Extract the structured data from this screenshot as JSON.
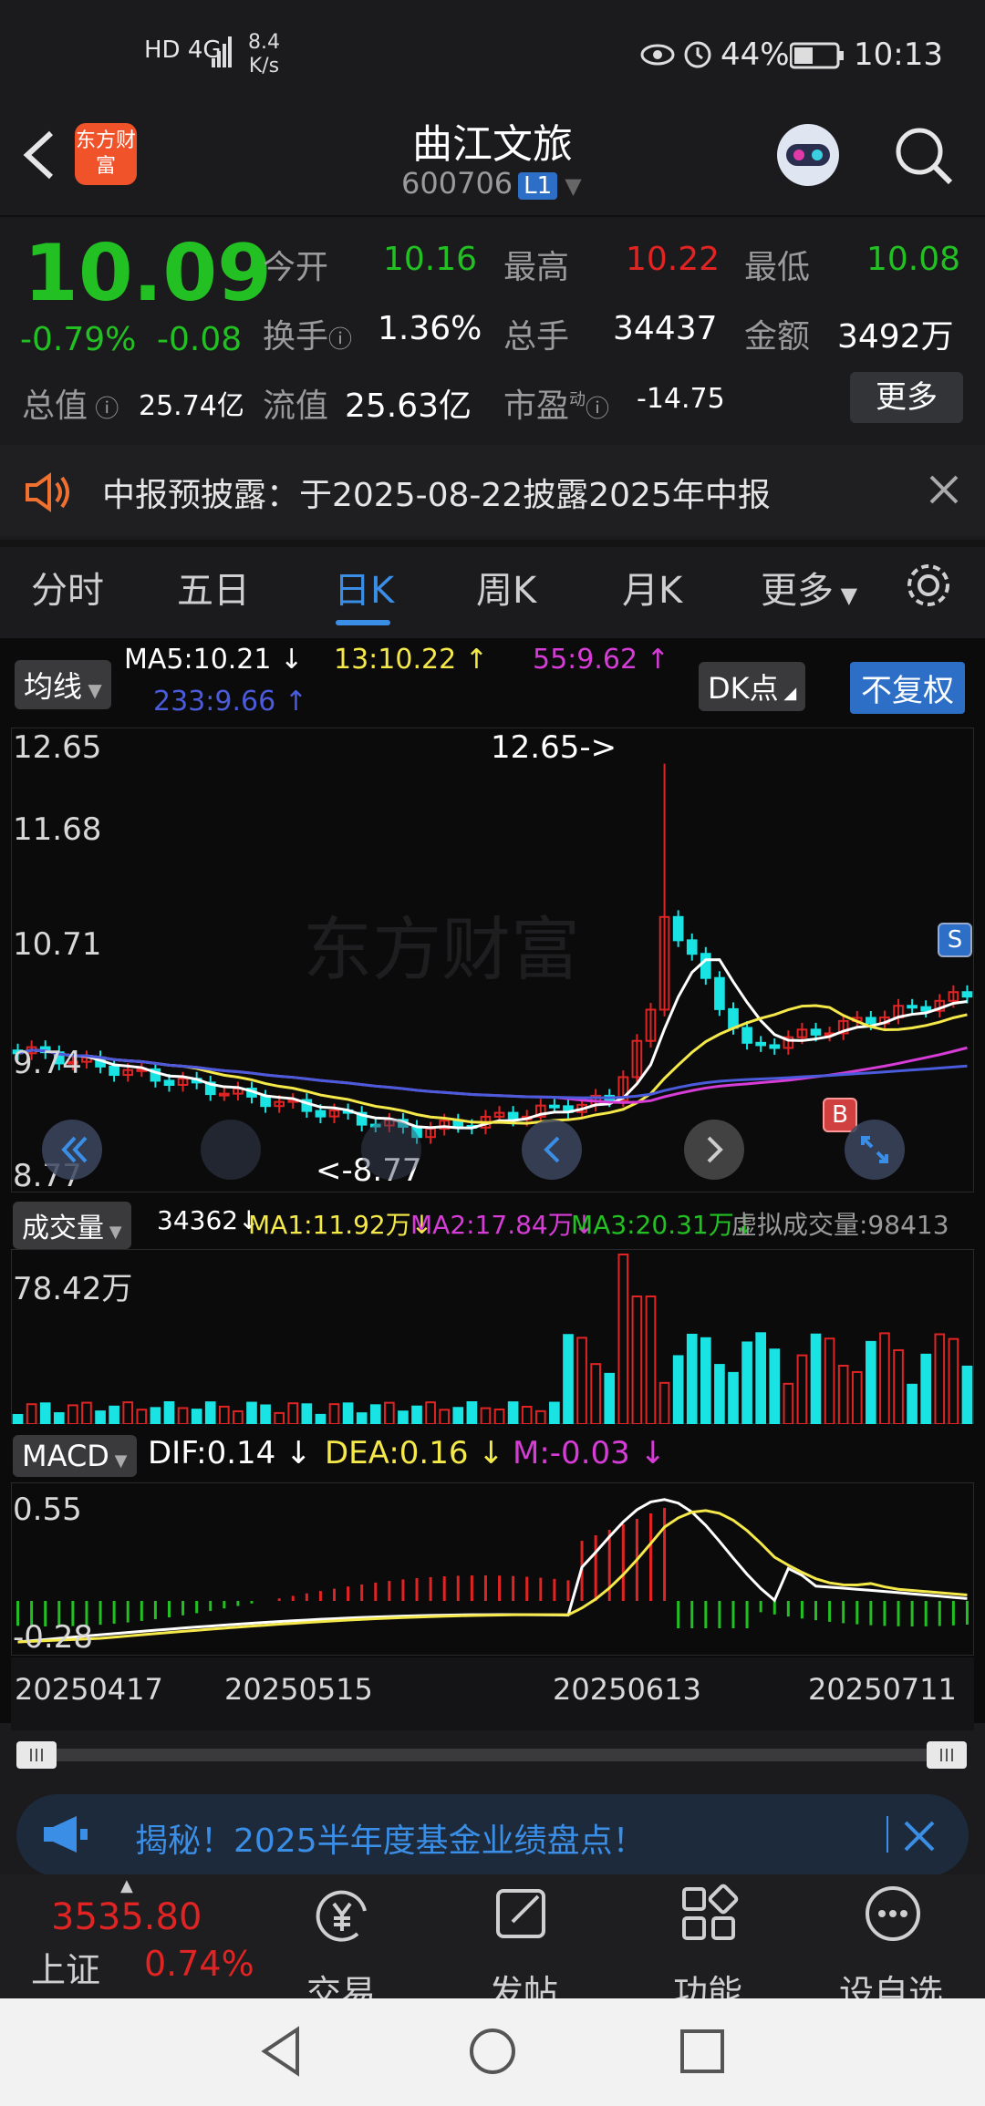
{
  "status_bar": {
    "left_icons": "HD 4G",
    "speed_value": "8.4",
    "speed_unit": "K/s",
    "battery": "44%",
    "time": "10:13"
  },
  "header": {
    "logo_text": "东方财富",
    "title": "曲江文旅",
    "code": "600706",
    "level": "L1"
  },
  "quote": {
    "price": "10.09",
    "change_pct": "-0.79%",
    "change": "-0.08",
    "open_label": "今开",
    "open": "10.16",
    "high_label": "最高",
    "high": "10.22",
    "low_label": "最低",
    "low": "10.08",
    "turnover_label": "换手",
    "turnover": "1.36%",
    "volume_label": "总手",
    "volume": "34437",
    "amount_label": "金额",
    "amount": "3492万",
    "mktcap_label": "总值",
    "mktcap": "25.74亿",
    "float_label": "流值",
    "float": "25.63亿",
    "pe_label": "市盈",
    "pe_sup": "动",
    "pe": "-14.75",
    "more_label": "更多"
  },
  "notice": {
    "text": "中报预披露：于2025-08-22披露2025年中报"
  },
  "tabs": [
    "分时",
    "五日",
    "日K",
    "周K",
    "月K",
    "更多"
  ],
  "active_tab": 2,
  "kline": {
    "ma_selector": "均线",
    "ma5": "MA5:10.21",
    "ma13": "13:10.22",
    "ma55": "55:9.62",
    "ma233": "233:9.66",
    "dk_label": "DK点",
    "adjust_label": "不复权",
    "y_labels": [
      "12.65",
      "11.68",
      "10.71",
      "9.74",
      "8.77"
    ],
    "high_marker": "12.65->",
    "low_marker": "<-8.77",
    "s_marker": "S",
    "b_marker": "B",
    "watermark": "东方财富"
  },
  "volume": {
    "selector": "成交量",
    "current": "34362",
    "ma1": "MA1:11.92万",
    "ma2": "MA2:17.84万",
    "ma3": "MA3:20.31万",
    "virtual": "虚拟成交量:98413",
    "y_label": "78.42万"
  },
  "macd": {
    "selector": "MACD",
    "dif": "DIF:0.14",
    "dea": "DEA:0.16",
    "m": "M:-0.03",
    "y_top": "0.55",
    "y_bottom": "-0.28"
  },
  "dates": [
    "20250417",
    "20250515",
    "20250613",
    "20250711"
  ],
  "banner": {
    "text": "揭秘！2025半年度基金业绩盘点！"
  },
  "bottom_nav": {
    "index_value": "3535.80",
    "index_name": "上证",
    "index_change": "0.74%",
    "items": [
      "交易",
      "发帖",
      "功能",
      "设自选"
    ]
  },
  "colors": {
    "up": "#e02424",
    "down": "#22c022",
    "accent": "#3a8ee6",
    "cyan": "#19e3e3",
    "yellow": "#f5e94a",
    "magenta": "#d63cd6",
    "white": "#ffffff",
    "blue_ma": "#4a5bdc"
  }
}
